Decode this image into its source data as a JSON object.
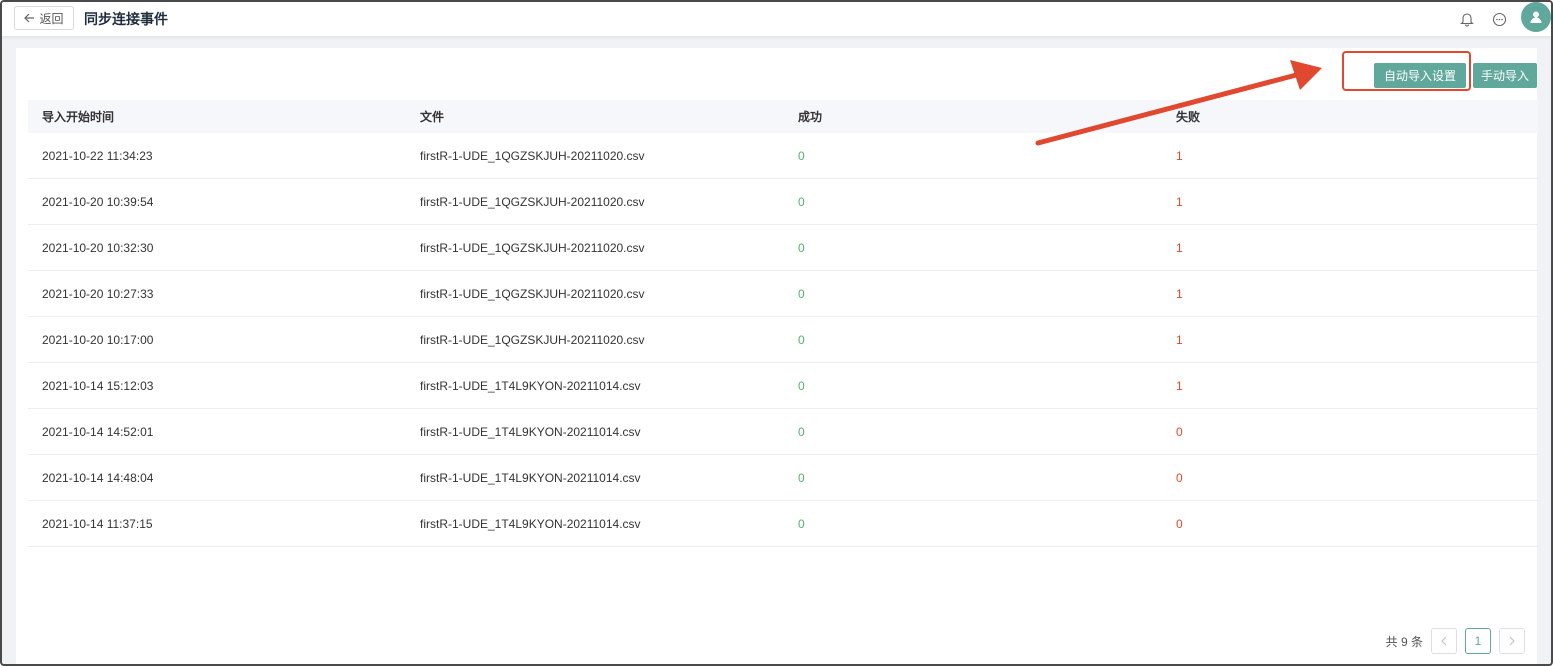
{
  "header": {
    "back_label": "返回",
    "title": "同步连接事件",
    "icons": [
      "bell-icon",
      "chat-icon",
      "user-avatar-icon"
    ]
  },
  "toolbar": {
    "auto_import_label": "自动导入设置",
    "manual_import_label": "手动导入"
  },
  "table": {
    "columns": [
      "导入开始时间",
      "文件",
      "成功",
      "失败"
    ],
    "rows": [
      {
        "time": "2021-10-22 11:34:23",
        "file": "firstR-1-UDE_1QGZSKJUH-20211020.csv",
        "success": "0",
        "fail": "1"
      },
      {
        "time": "2021-10-20 10:39:54",
        "file": "firstR-1-UDE_1QGZSKJUH-20211020.csv",
        "success": "0",
        "fail": "1"
      },
      {
        "time": "2021-10-20 10:32:30",
        "file": "firstR-1-UDE_1QGZSKJUH-20211020.csv",
        "success": "0",
        "fail": "1"
      },
      {
        "time": "2021-10-20 10:27:33",
        "file": "firstR-1-UDE_1QGZSKJUH-20211020.csv",
        "success": "0",
        "fail": "1"
      },
      {
        "time": "2021-10-20 10:17:00",
        "file": "firstR-1-UDE_1QGZSKJUH-20211020.csv",
        "success": "0",
        "fail": "1"
      },
      {
        "time": "2021-10-14 15:12:03",
        "file": "firstR-1-UDE_1T4L9KYON-20211014.csv",
        "success": "0",
        "fail": "1"
      },
      {
        "time": "2021-10-14 14:52:01",
        "file": "firstR-1-UDE_1T4L9KYON-20211014.csv",
        "success": "0",
        "fail": "0"
      },
      {
        "time": "2021-10-14 14:48:04",
        "file": "firstR-1-UDE_1T4L9KYON-20211014.csv",
        "success": "0",
        "fail": "0"
      },
      {
        "time": "2021-10-14 11:37:15",
        "file": "firstR-1-UDE_1T4L9KYON-20211014.csv",
        "success": "0",
        "fail": "0"
      }
    ]
  },
  "pagination": {
    "total_label": "共 9 条",
    "current_page": "1"
  },
  "colors": {
    "accent": "#5fa89b",
    "success": "#52b36a",
    "fail": "#e0492f",
    "annotation": "#e0492f"
  }
}
